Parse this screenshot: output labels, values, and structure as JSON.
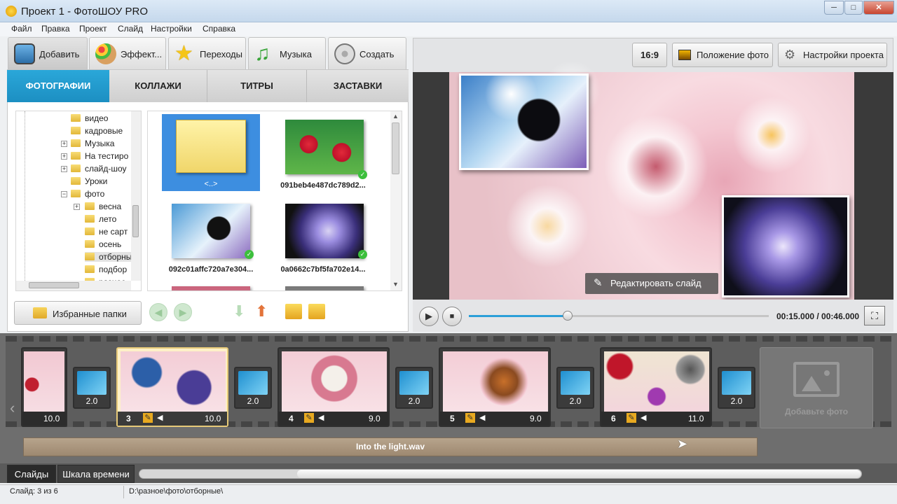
{
  "window": {
    "title": "Проект 1 - ФотоШОУ PRO",
    "controls": [
      "─",
      "□",
      "✕"
    ]
  },
  "menu": [
    "Файл",
    "Правка",
    "Проект",
    "Слайд",
    "Настройки",
    "Справка"
  ],
  "main_tabs": [
    {
      "label": "Добавить",
      "icon": "camera-icon",
      "active": true
    },
    {
      "label": "Эффект...",
      "icon": "palette-icon"
    },
    {
      "label": "Переходы",
      "icon": "star-icon"
    },
    {
      "label": "Музыка",
      "icon": "music-note-icon"
    },
    {
      "label": "Создать",
      "icon": "film-reel-icon"
    }
  ],
  "sub_tabs": [
    {
      "label": "ФОТОГРАФИИ",
      "active": true
    },
    {
      "label": "КОЛЛАЖИ"
    },
    {
      "label": "ТИТРЫ"
    },
    {
      "label": "ЗАСТАВКИ"
    }
  ],
  "tree": [
    {
      "label": "видео",
      "level": 0,
      "expandable": false
    },
    {
      "label": "кадровые",
      "level": 0,
      "expandable": false
    },
    {
      "label": "Музыка",
      "level": 0,
      "expandable": true
    },
    {
      "label": "На тестиро",
      "level": 0,
      "expandable": true
    },
    {
      "label": "слайд-шоу",
      "level": 0,
      "expandable": true
    },
    {
      "label": "Уроки",
      "level": 0,
      "expandable": false
    },
    {
      "label": "фото",
      "level": 0,
      "expandable": true,
      "expanded": true
    },
    {
      "label": "весна",
      "level": 1,
      "expandable": true
    },
    {
      "label": "лето",
      "level": 1,
      "expandable": false
    },
    {
      "label": "не сарт",
      "level": 1,
      "expandable": false
    },
    {
      "label": "осень",
      "level": 1,
      "expandable": false
    },
    {
      "label": "отборны",
      "level": 1,
      "expandable": false,
      "selected": true
    },
    {
      "label": "подбор",
      "level": 1,
      "expandable": false
    },
    {
      "label": "разное",
      "level": 1,
      "expandable": false
    }
  ],
  "files": [
    {
      "caption": "<..>",
      "type": "folder",
      "selected": true
    },
    {
      "caption": "091beb4e487dc789d2...",
      "type": "raspberry",
      "checked": true
    },
    {
      "caption": "092c01affc720a7e304...",
      "type": "cat",
      "checked": true
    },
    {
      "caption": "0a0662c7bf5fa702e14...",
      "type": "flower",
      "checked": true
    }
  ],
  "fav_button": "Избранные папки",
  "right_toolbar": {
    "ratio": "16:9",
    "photo_position": "Положение фото",
    "project_settings": "Настройки проекта"
  },
  "preview": {
    "edit_button": "Редактировать слайд"
  },
  "player": {
    "time": "00:15.000 / 00:46.000",
    "progress": 0.33
  },
  "slides": [
    {
      "num": "",
      "duration": "10.0",
      "partial": true
    },
    {
      "num": "3",
      "duration": "10.0",
      "active": true
    },
    {
      "num": "4",
      "duration": "9.0"
    },
    {
      "num": "5",
      "duration": "9.0"
    },
    {
      "num": "6",
      "duration": "11.0"
    }
  ],
  "transitions": [
    "2.0",
    "2.0",
    "2.0",
    "2.0",
    "2.0"
  ],
  "add_photo": "Добавьте фото",
  "audio_track": "Into the light.wav",
  "bottom_tabs": [
    {
      "label": "Слайды",
      "active": true
    },
    {
      "label": "Шкала времени"
    }
  ],
  "status": {
    "slide": "Слайд: 3 из 6",
    "path": "D:\\разное\\фото\\отборные\\"
  }
}
